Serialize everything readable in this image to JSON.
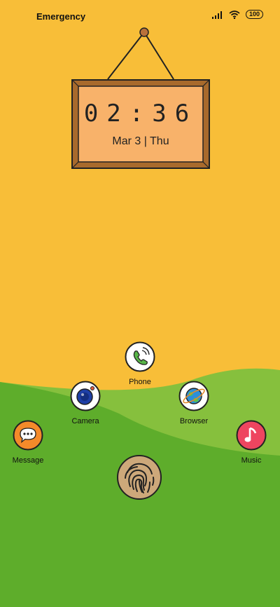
{
  "status_bar": {
    "carrier": "Emergency",
    "battery": "100"
  },
  "widget": {
    "time": "02:36",
    "date": "Mar 3 | Thu"
  },
  "apps": {
    "phone": "Phone",
    "camera": "Camera",
    "browser": "Browser",
    "message": "Message",
    "music": "Music"
  },
  "colors": {
    "sky": "#F8BE38",
    "hill_light": "#86C03D",
    "hill_dark": "#5EAD2B",
    "frame": "#A86A2C",
    "frame_inner": "#F8B26A"
  }
}
